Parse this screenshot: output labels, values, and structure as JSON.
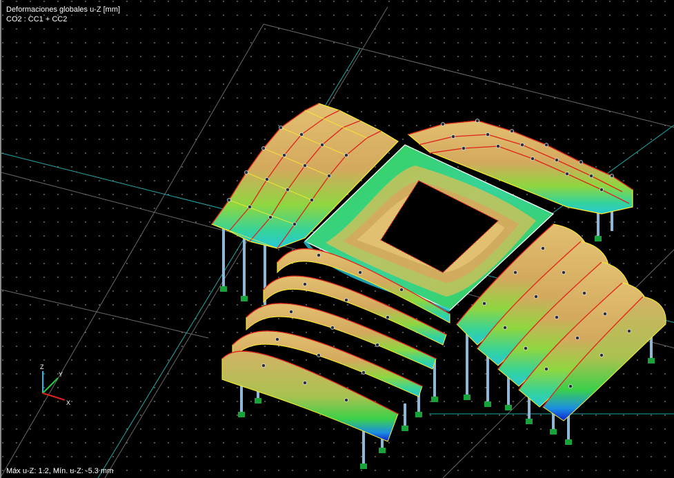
{
  "viewport": {
    "title": "Deformaciones globales u-Z [mm]",
    "load_case": "CO2 : CC1 + CC2",
    "summary": "Máx u-Z: 1.2, Mín. u-Z: -5.3 mm"
  },
  "axes": {
    "x": "X",
    "y": "Y",
    "z": "Z"
  },
  "colors": {
    "background": "#000000",
    "grid_dot": "#8c8c8c",
    "grid_line": "#6a6a6a",
    "axis_line": "#1fa9a9",
    "member_red": "#e0201a",
    "member_yellow": "#ffef2a",
    "node_dark": "#2b2f3d",
    "column": "#8fb7d6",
    "support": "#18a33a",
    "contour": [
      "#0b1fd0",
      "#1d8fe0",
      "#26c7d8",
      "#35d39a",
      "#3bd04a",
      "#8fd640",
      "#c9c25a",
      "#d4a95e",
      "#e2c071"
    ]
  }
}
